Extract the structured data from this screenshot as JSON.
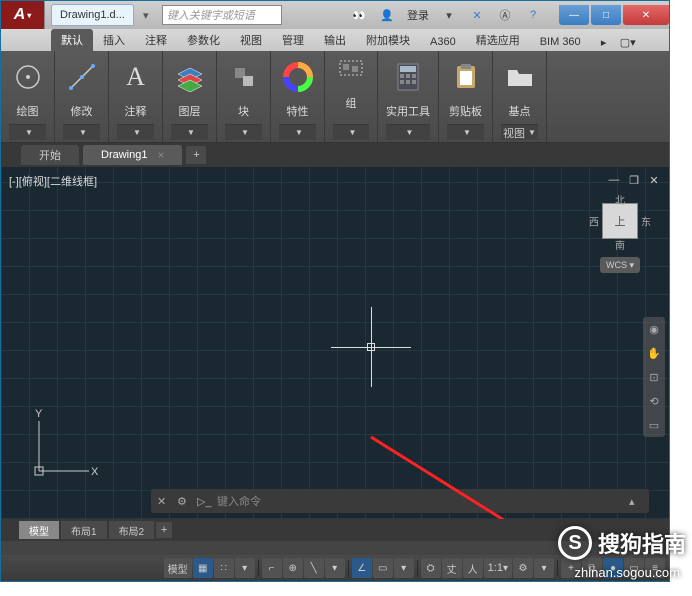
{
  "title": {
    "doc": "Drawing1.d..."
  },
  "search": {
    "placeholder": "键入关键字或短语"
  },
  "login": "登录",
  "ribbon_tabs": [
    "默认",
    "插入",
    "注释",
    "参数化",
    "视图",
    "管理",
    "输出",
    "附加模块",
    "A360",
    "精选应用",
    "BIM 360"
  ],
  "panels": [
    {
      "label": "绘图"
    },
    {
      "label": "修改"
    },
    {
      "label": "注释"
    },
    {
      "label": "图层"
    },
    {
      "label": "块"
    },
    {
      "label": "特性"
    },
    {
      "label": "组"
    },
    {
      "label": "实用工具"
    },
    {
      "label": "剪贴板"
    },
    {
      "label": "基点"
    }
  ],
  "view_footer": "视图",
  "doc_tabs": {
    "start": "开始",
    "drawing": "Drawing1"
  },
  "viewport": {
    "label": "[-][俯视][二维线框]"
  },
  "viewcube": {
    "n": "北",
    "s": "南",
    "e": "东",
    "w": "西",
    "top": "上",
    "wcs": "WCS ▾"
  },
  "ucs": {
    "x": "X",
    "y": "Y"
  },
  "cmd": {
    "placeholder": "键入命令"
  },
  "layout_tabs": [
    "模型",
    "布局1",
    "布局2"
  ],
  "status": {
    "model": "模型",
    "scale": "1:1"
  },
  "watermark": {
    "brand": "搜狗指南",
    "url": "zhinan.sogou.com",
    "logo": "S"
  }
}
